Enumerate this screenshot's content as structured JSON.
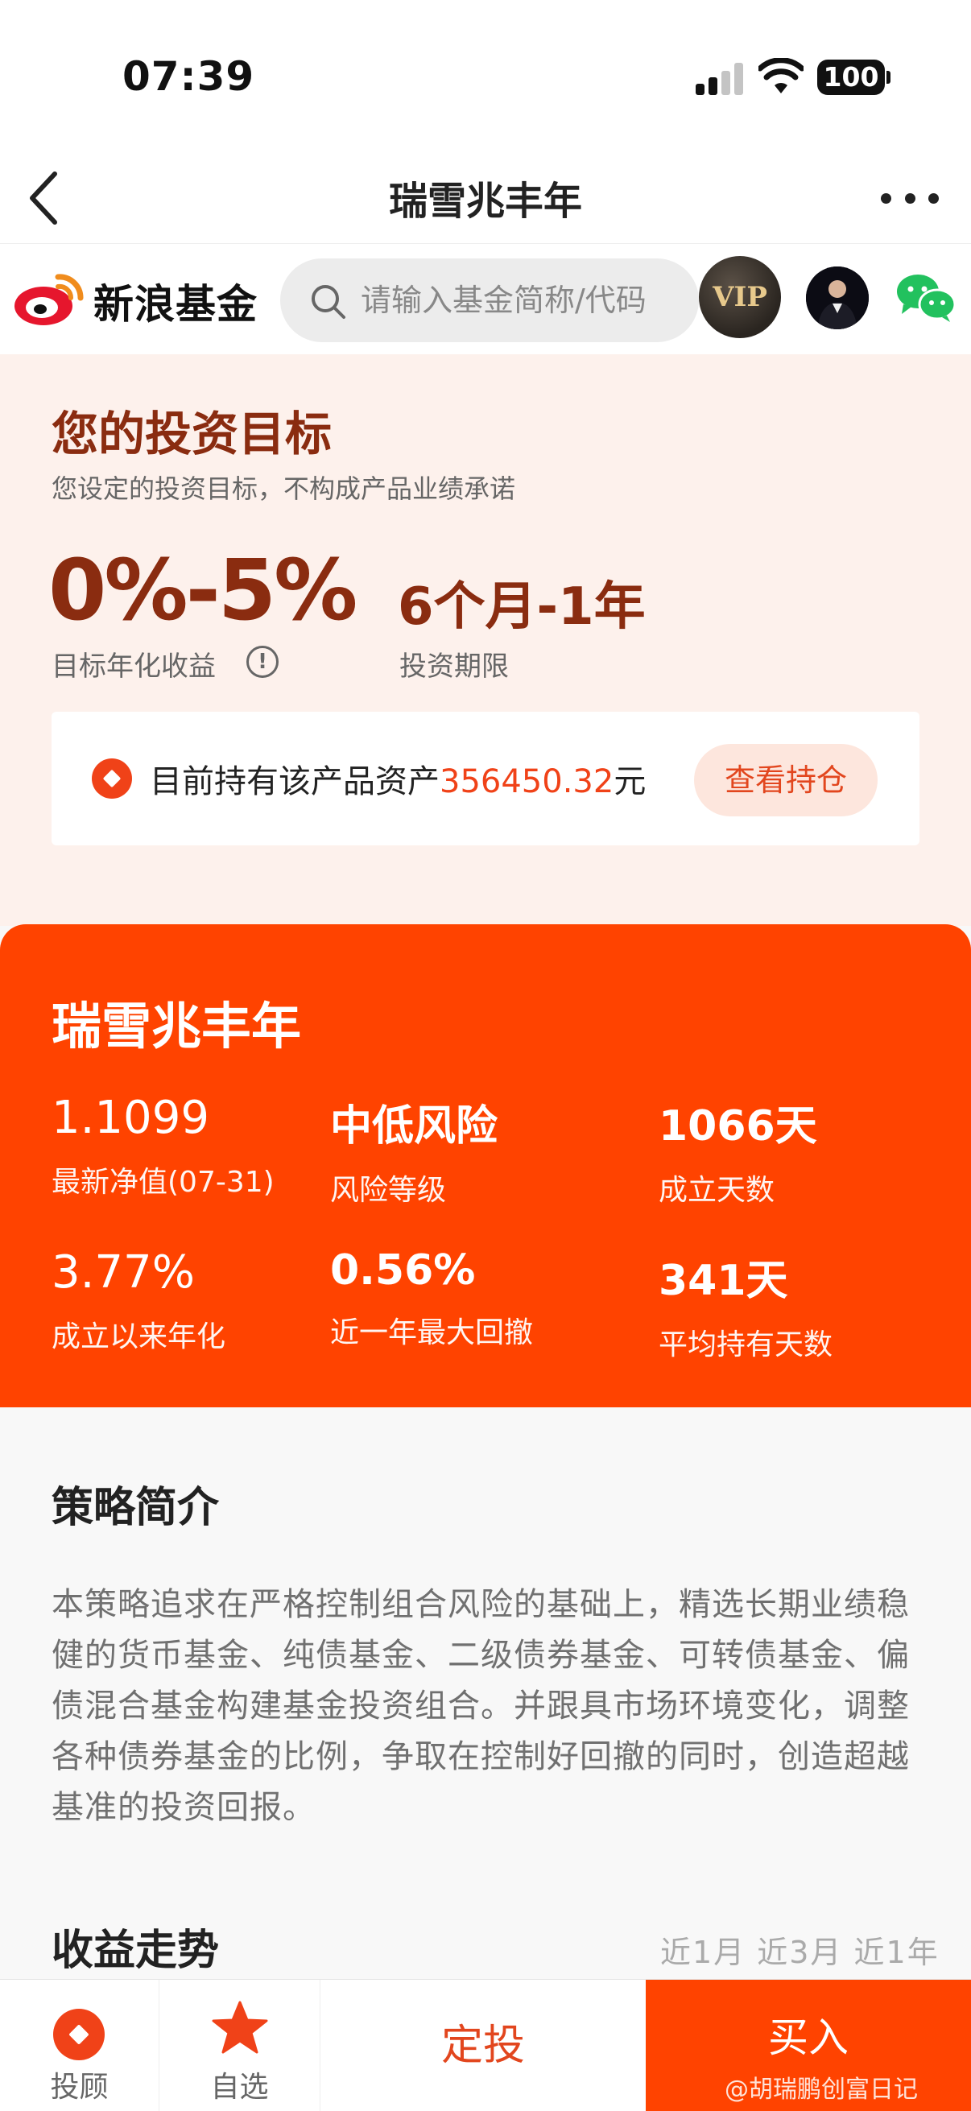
{
  "status_bar": {
    "time": "07:39",
    "battery": "100"
  },
  "nav": {
    "title": "瑞雪兆丰年"
  },
  "header": {
    "logo_text": "新浪基金",
    "search_placeholder": "请输入基金简称/代码",
    "vip_label": "VIP"
  },
  "goal": {
    "title": "您的投资目标",
    "subtitle": "您设定的投资目标，不构成产品业绩承诺",
    "return_value": "0%-5%",
    "return_label": "目标年化收益",
    "info_icon_glyph": "!",
    "period_value": "6个月-1年",
    "period_label": "投资期限",
    "holdings_prefix": "目前持有该产品资产",
    "holdings_amount": "356450.32",
    "holdings_suffix": "元",
    "view_holdings_label": "查看持仓"
  },
  "product": {
    "name": "瑞雪兆丰年",
    "stats": [
      {
        "value": "1.1099",
        "label": "最新净值(07-31)"
      },
      {
        "value": "中低风险",
        "label": "风险等级"
      },
      {
        "value": "1066天",
        "label": "成立天数"
      },
      {
        "value": "3.77%",
        "label": "成立以来年化"
      },
      {
        "value": "0.56%",
        "label": "近一年最大回撤"
      },
      {
        "value": "341天",
        "label": "平均持有天数"
      }
    ]
  },
  "strategy": {
    "title": "策略简介",
    "body": "本策略追求在严格控制组合风险的基础上，精选长期业绩稳健的货币基金、纯债基金、二级债券基金、可转债基金、偏债混合基金构建基金投资组合。并跟具市场环境变化，调整各种债券基金的比例，争取在控制好回撤的同时，创造超越基准的投资回报。"
  },
  "trend": {
    "title": "收益走势",
    "tabs_text": "近1月  近3月  近1年"
  },
  "bottom_bar": {
    "advisor_label": "投顾",
    "watchlist_label": "自选",
    "sip_label": "定投",
    "buy_label": "买入"
  },
  "watermark": "@胡瑞鹏创富日记",
  "colors": {
    "accent": "#ff4300",
    "accent_dark": "#8a2c10",
    "goal_background": "#fdf1ec",
    "button_tint": "#fde6dd"
  }
}
